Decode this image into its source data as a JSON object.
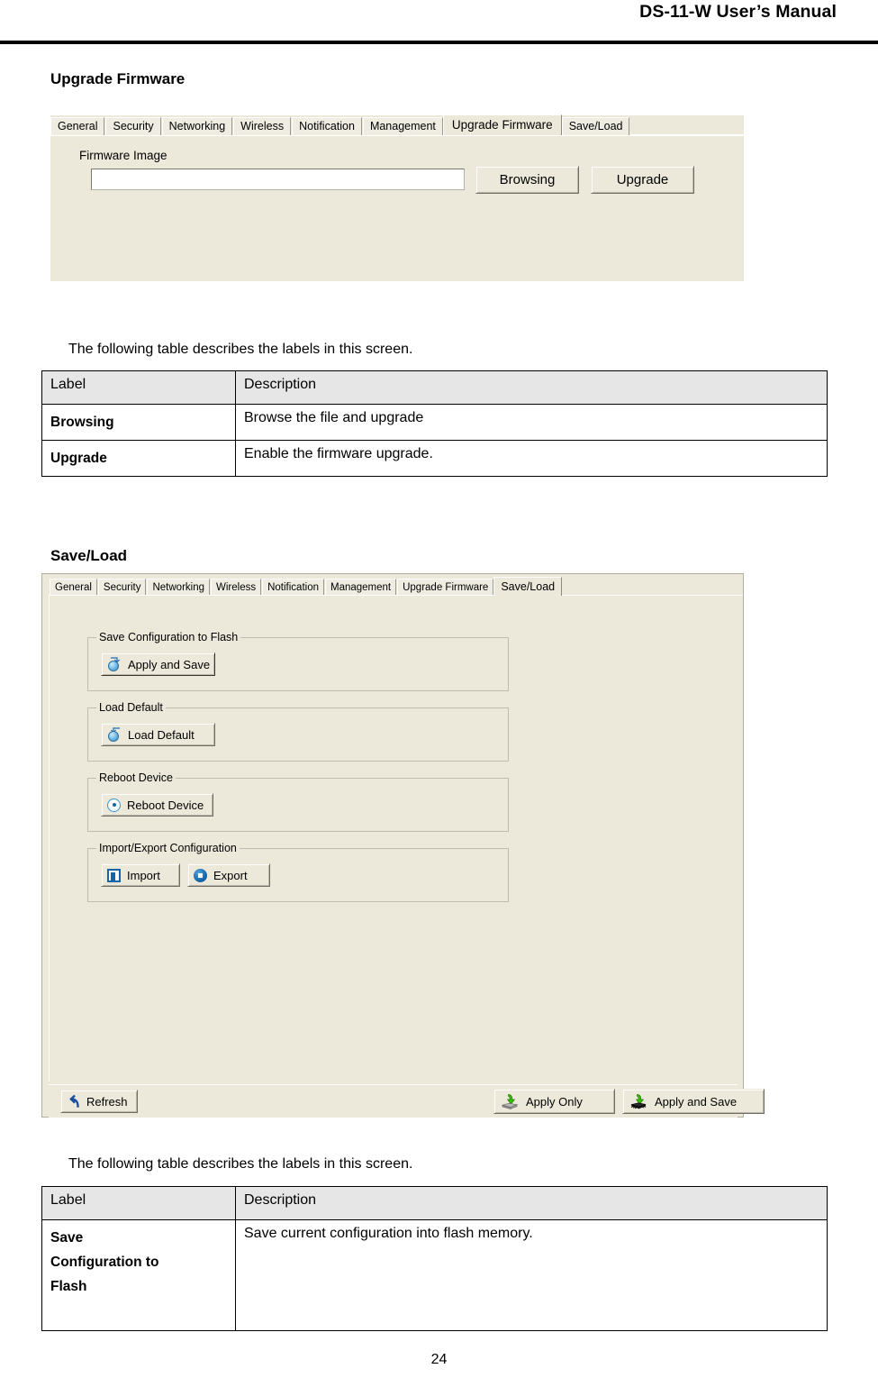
{
  "header": {
    "manual_title": "DS-11-W User’s Manual"
  },
  "sections": {
    "upgrade_firmware": {
      "heading": "Upgrade Firmware",
      "tabs": [
        {
          "label": "General",
          "active": false
        },
        {
          "label": "Security",
          "active": false
        },
        {
          "label": "Networking",
          "active": false
        },
        {
          "label": "Wireless",
          "active": false
        },
        {
          "label": "Notification",
          "active": false
        },
        {
          "label": "Management",
          "active": false
        },
        {
          "label": "Upgrade Firmware",
          "active": true
        },
        {
          "label": "Save/Load",
          "active": false
        }
      ],
      "firmware_image_label": "Firmware Image",
      "firmware_image_value": "",
      "firmware_image_placeholder": "",
      "browsing_button": "Browsing",
      "upgrade_button": "Upgrade",
      "intro_text": "The following table describes the labels in this screen.",
      "table": {
        "columns": [
          "Label",
          "Description"
        ],
        "rows": [
          [
            "Browsing",
            "Browse the file and upgrade"
          ],
          [
            "Upgrade",
            "Enable the firmware upgrade."
          ]
        ]
      }
    },
    "save_load": {
      "heading": "Save/Load",
      "tabs": [
        {
          "label": "General",
          "active": false
        },
        {
          "label": "Security",
          "active": false
        },
        {
          "label": "Networking",
          "active": false
        },
        {
          "label": "Wireless",
          "active": false
        },
        {
          "label": "Notification",
          "active": false
        },
        {
          "label": "Management",
          "active": false
        },
        {
          "label": "Upgrade Firmware",
          "active": false
        },
        {
          "label": "Save/Load",
          "active": true
        }
      ],
      "groups": {
        "save_config": {
          "legend": "Save Configuration to Flash",
          "button": "Apply and Save",
          "icon": "ball-arrow-icon"
        },
        "load_default": {
          "legend": "Load Default",
          "button": "Load Default",
          "icon": "ball-arrow-back-icon"
        },
        "reboot_device": {
          "legend": "Reboot Device",
          "button": "Reboot Device",
          "icon": "power-radio-icon"
        },
        "import_export": {
          "legend": "Import/Export Configuration",
          "import_button": "Import",
          "import_icon": "square-import-icon",
          "export_button": "Export",
          "export_icon": "circle-export-icon"
        }
      },
      "actionbar": {
        "refresh_button": "Refresh",
        "refresh_icon": "undo-arrow-icon",
        "apply_only_button": "Apply Only",
        "apply_only_icon": "green-arrow-disk-icon",
        "apply_and_save_button": "Apply and Save",
        "apply_and_save_icon": "green-arrow-chip-icon"
      },
      "intro_text": "The following table describes the labels in this screen.",
      "table": {
        "columns": [
          "Label",
          "Description"
        ],
        "rows": [
          [
            "Save\nConfiguration to\nFlash",
            "Save current configuration into flash memory."
          ]
        ]
      }
    }
  },
  "footer": {
    "page_number": "24"
  },
  "colors": {
    "panel_bg": "#ECE9DB",
    "table_header_bg": "#E6E6E6",
    "accent_blue": "#1764A8",
    "accent_green": "#35C000"
  }
}
